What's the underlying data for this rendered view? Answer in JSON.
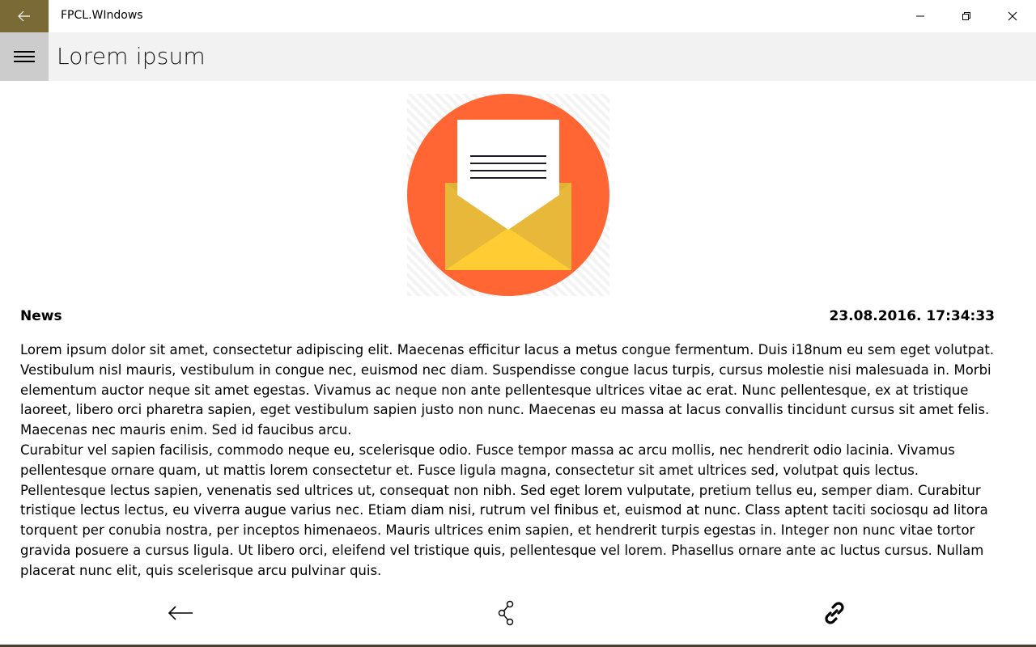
{
  "window": {
    "title": "FPCL.WIndows",
    "accent_color": "#7a6b36"
  },
  "header": {
    "title": "Lorem ipsum"
  },
  "article": {
    "category": "News",
    "date": "23.08.2016. 17:34:33",
    "image_icon": "envelope-letter-icon",
    "paragraphs": [
      "Lorem ipsum dolor sit amet, consectetur adipiscing elit. Maecenas efficitur lacus a metus congue fermentum. Duis i18num eu sem eget volutpat. Vestibulum nisl mauris, vestibulum in congue nec, euismod nec diam. Suspendisse congue lacus turpis, cursus molestie nisi malesuada in. Morbi elementum auctor neque sit amet egestas. Vivamus ac neque non ante pellentesque ultrices vitae ac erat. Nunc pellentesque, ex at tristique laoreet, libero orci pharetra sapien, eget vestibulum sapien justo non nunc. Maecenas eu massa at lacus convallis tincidunt cursus sit amet felis. Maecenas nec mauris enim. Sed id faucibus arcu.",
      "Curabitur vel sapien facilisis, commodo neque eu, scelerisque odio. Fusce tempor massa ac arcu mollis, nec hendrerit odio lacinia. Vivamus pellentesque ornare quam, ut mattis lorem consectetur et. Fusce ligula magna, consectetur sit amet ultrices sed, volutpat quis lectus. Pellentesque lectus sapien, venenatis sed ultrices ut, consequat non nibh. Sed eget lorem vulputate, pretium tellus eu, semper diam. Curabitur tristique lectus lectus, eu viverra augue varius nec. Etiam diam nisi, rutrum vel finibus et, euismod at nunc. Class aptent taciti sociosqu ad litora torquent per conubia nostra, per inceptos himenaeos. Mauris ultrices enim sapien, et hendrerit turpis egestas in. Integer non nunc vitae tortor gravida posuere a cursus ligula. Ut libero orci, eleifend vel tristique quis, pellentesque vel lorem. Phasellus ornare ante ac luctus cursus. Nullam placerat nunc elit, quis scelerisque arcu pulvinar quis."
    ]
  },
  "command_bar": {
    "items": [
      {
        "icon": "arrow-left-icon"
      },
      {
        "icon": "share-icon"
      },
      {
        "icon": "link-icon"
      }
    ]
  }
}
